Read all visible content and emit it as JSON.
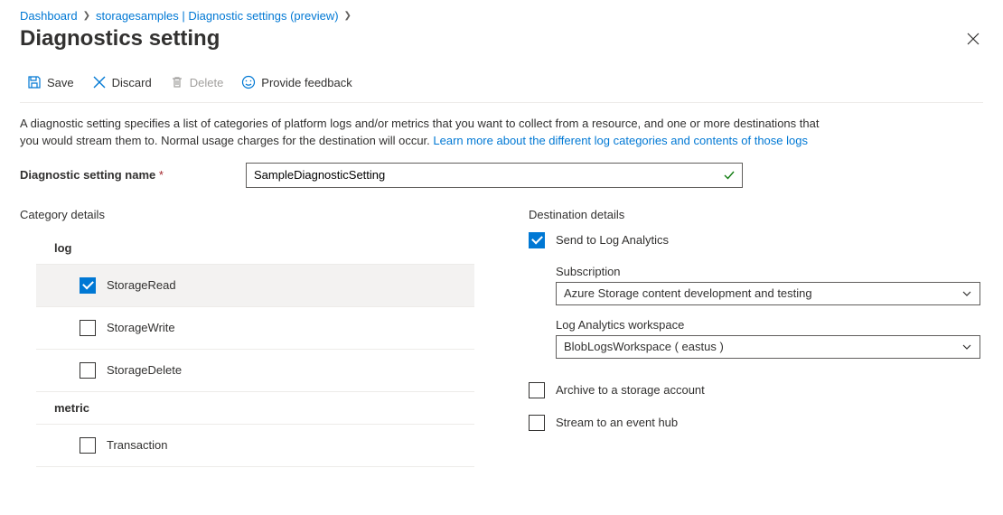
{
  "breadcrumb": {
    "items": [
      "Dashboard",
      "storagesamples | Diagnostic settings (preview)"
    ]
  },
  "page_title": "Diagnostics setting",
  "toolbar": {
    "save": "Save",
    "discard": "Discard",
    "delete": "Delete",
    "feedback": "Provide feedback"
  },
  "description": {
    "text": "A diagnostic setting specifies a list of categories of platform logs and/or metrics that you want to collect from a resource, and one or more destinations that you would stream them to. Normal usage charges for the destination will occur. ",
    "link_text": "Learn more about the different log categories and contents of those logs"
  },
  "setting_name": {
    "label": "Diagnostic setting name",
    "value": "SampleDiagnosticSetting"
  },
  "category": {
    "title": "Category details",
    "log_label": "log",
    "logs": [
      {
        "label": "StorageRead",
        "checked": true
      },
      {
        "label": "StorageWrite",
        "checked": false
      },
      {
        "label": "StorageDelete",
        "checked": false
      }
    ],
    "metric_label": "metric",
    "metrics": [
      {
        "label": "Transaction",
        "checked": false
      }
    ]
  },
  "destination": {
    "title": "Destination details",
    "send_log_analytics": {
      "label": "Send to Log Analytics",
      "checked": true
    },
    "subscription": {
      "label": "Subscription",
      "value": "Azure Storage content development and testing"
    },
    "workspace": {
      "label": "Log Analytics workspace",
      "value": "BlobLogsWorkspace ( eastus )"
    },
    "archive": {
      "label": "Archive to a storage account",
      "checked": false
    },
    "stream": {
      "label": "Stream to an event hub",
      "checked": false
    }
  }
}
